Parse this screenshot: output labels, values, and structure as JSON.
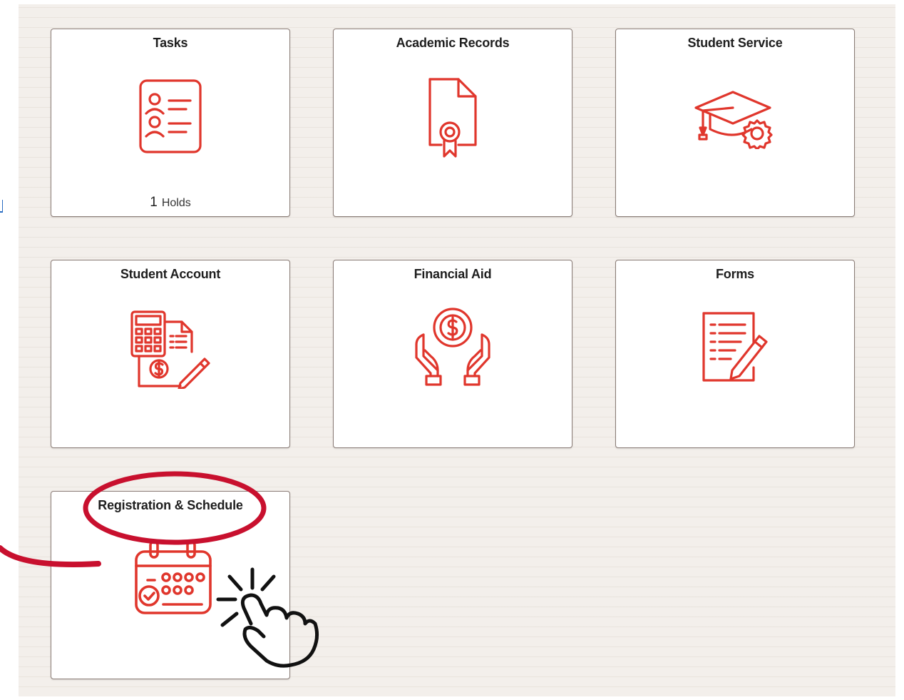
{
  "tiles": [
    {
      "title": "Tasks",
      "icon": "task-list-icon",
      "count": "1",
      "count_label": "Holds"
    },
    {
      "title": "Academic Records",
      "icon": "certificate-document-icon"
    },
    {
      "title": "Student Service",
      "icon": "graduation-cap-gear-icon"
    },
    {
      "title": "Student Account",
      "icon": "calculator-bill-icon"
    },
    {
      "title": "Financial Aid",
      "icon": "hands-coin-icon"
    },
    {
      "title": "Forms",
      "icon": "form-pencil-icon"
    },
    {
      "title": "Registration & Schedule",
      "icon": "calendar-check-icon"
    }
  ],
  "colors": {
    "icon": "#e0362c",
    "annotation": "#c8102e",
    "tile_border": "#8a7c76",
    "background": "#f3efeb",
    "link": "#2a6dc2"
  },
  "annotation": {
    "circle_highlight": "registration-title-circle",
    "pointer_icon": "hand-pointer-click-icon"
  }
}
